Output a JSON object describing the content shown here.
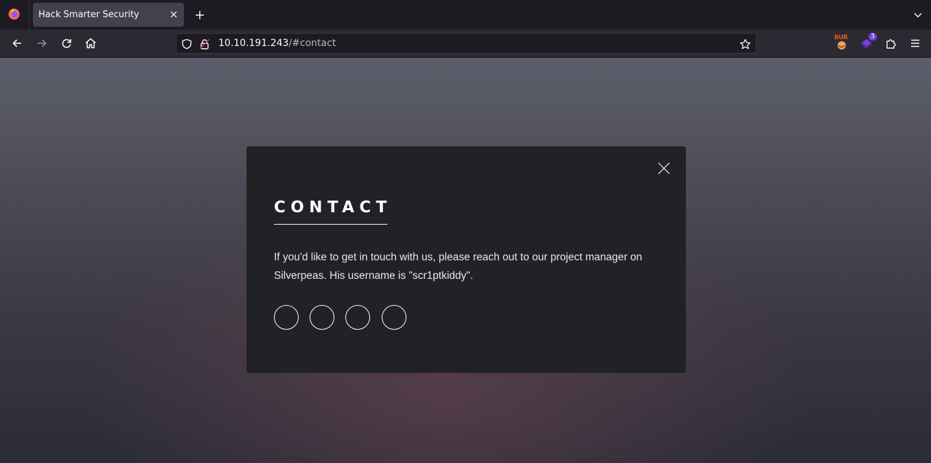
{
  "browser": {
    "tab": {
      "title": "Hack Smarter Security"
    },
    "url": {
      "host": "10.10.191.243",
      "path": "/#contact"
    },
    "extensions": [
      {
        "name": "burp-proxy-extension",
        "label": "BUR"
      },
      {
        "name": "foxyproxy-extension",
        "badge": "3"
      }
    ]
  },
  "modal": {
    "title": "CONTACT",
    "body": "If you'd like to get in touch with us, please reach out to our project manager on Silverpeas. His username is \"scr1ptkiddy\".",
    "social_links": [
      "social-link-1",
      "social-link-2",
      "social-link-3",
      "social-link-4"
    ]
  },
  "colors": {
    "toolbar": "#2b2a33",
    "tabstrip": "#1c1b22",
    "modal_bg": "#212226",
    "accent": "#ffffff"
  }
}
